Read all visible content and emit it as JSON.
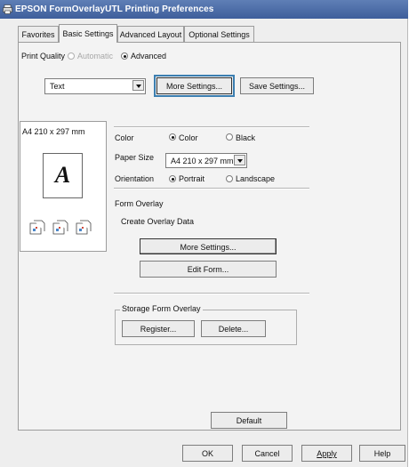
{
  "window": {
    "title": "EPSON FormOverlayUTL Printing Preferences"
  },
  "tabs": [
    {
      "label": "Favorites"
    },
    {
      "label": "Basic Settings"
    },
    {
      "label": "Advanced Layout"
    },
    {
      "label": "Optional Settings"
    }
  ],
  "print_quality": {
    "label": "Print Quality",
    "automatic": "Automatic",
    "advanced": "Advanced",
    "selected": "Advanced",
    "combo_value": "Text",
    "more_settings": "More Settings...",
    "save_settings": "Save Settings..."
  },
  "preview": {
    "paper_label": "A4 210 x 297 mm",
    "page_letter": "A"
  },
  "color": {
    "label": "Color",
    "opt_color": "Color",
    "opt_black": "Black",
    "selected": "Color"
  },
  "paper_size": {
    "label": "Paper Size",
    "value": "A4 210 x 297 mm"
  },
  "orientation": {
    "label": "Orientation",
    "opt_portrait": "Portrait",
    "opt_landscape": "Landscape",
    "selected": "Portrait"
  },
  "form_overlay": {
    "label": "Form Overlay",
    "create_label": "Create Overlay Data",
    "more_settings": "More Settings...",
    "edit_form": "Edit Form..."
  },
  "storage": {
    "title": "Storage Form Overlay",
    "register": "Register...",
    "delete": "Delete..."
  },
  "buttons": {
    "default": "Default",
    "ok": "OK",
    "cancel": "Cancel",
    "apply": "Apply",
    "help": "Help"
  }
}
